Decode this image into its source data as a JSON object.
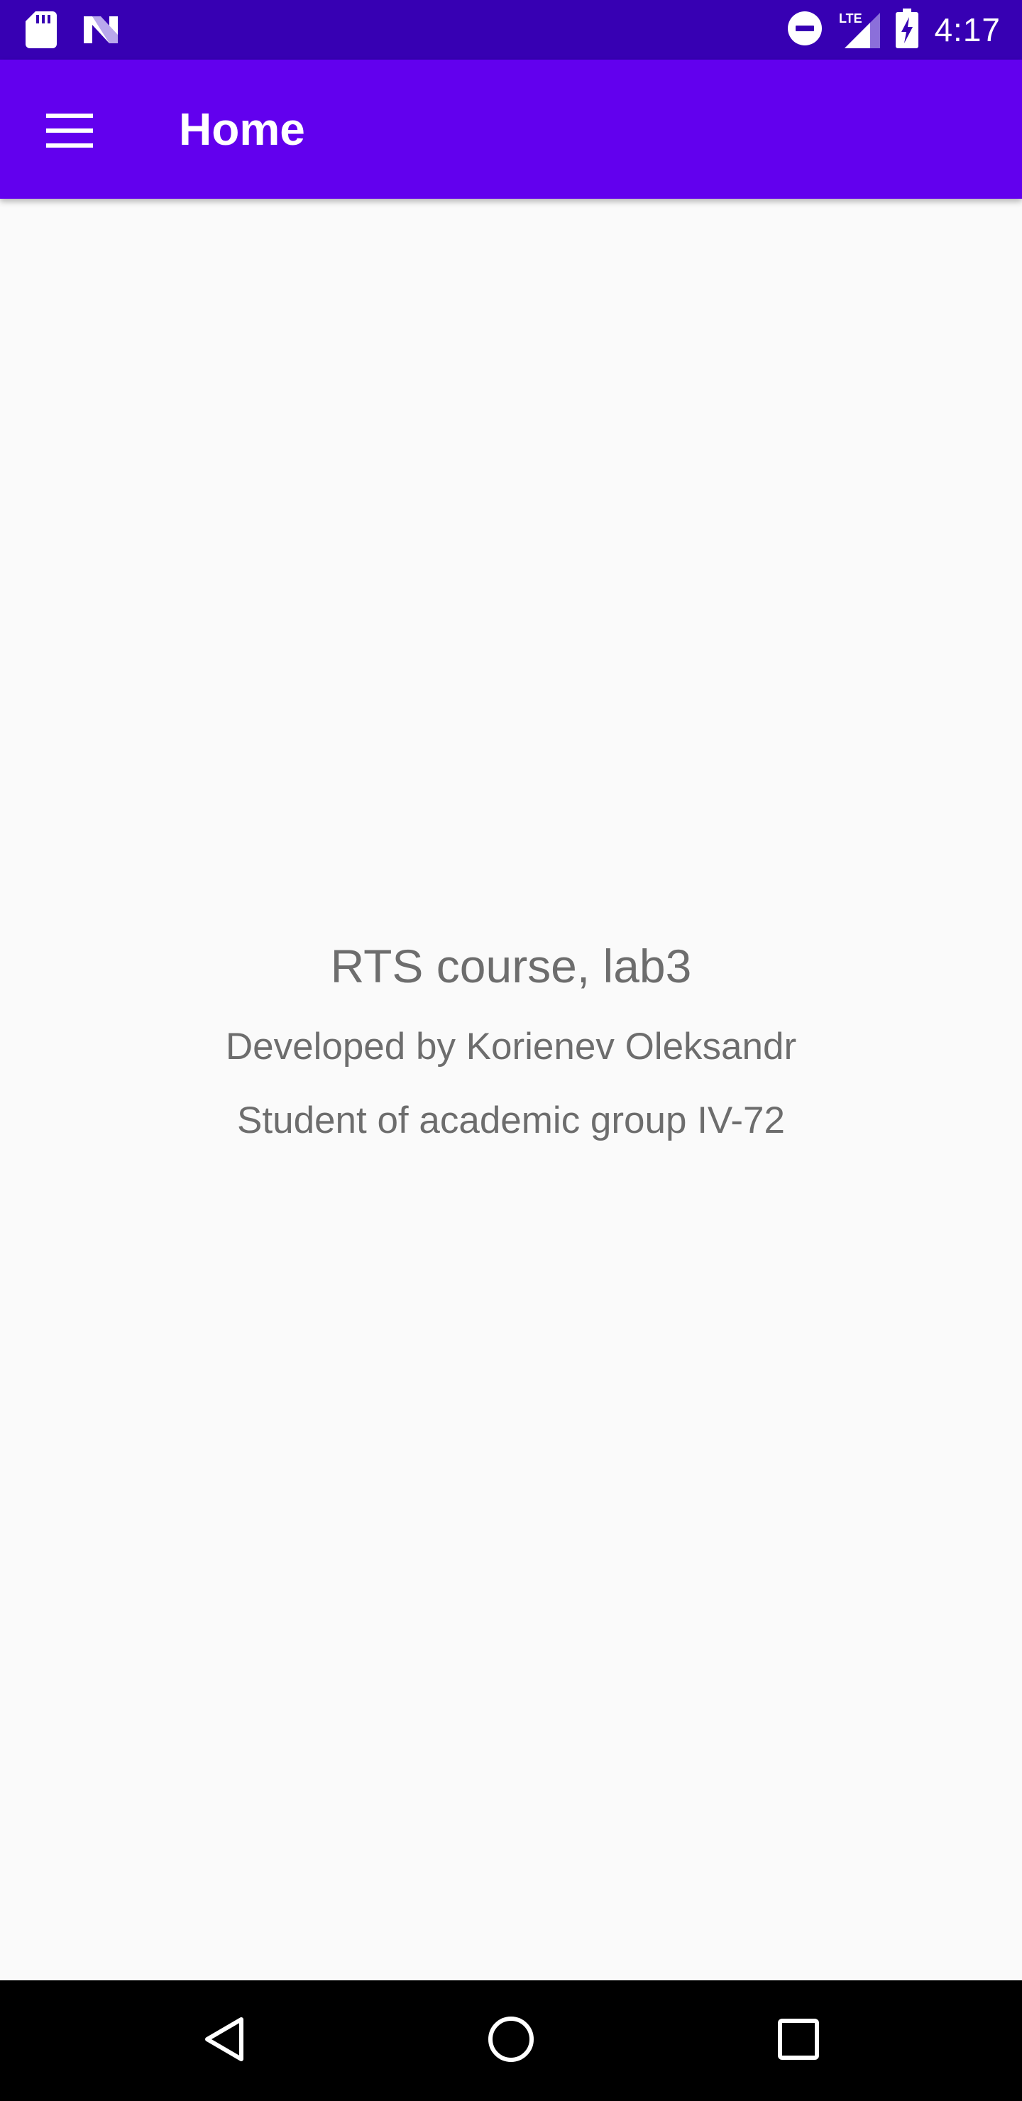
{
  "status_bar": {
    "time": "4:17",
    "icons": [
      "sd-card-icon",
      "n-logo-icon",
      "do-not-disturb-icon",
      "lte-signal-icon",
      "battery-charging-icon"
    ],
    "lte_label": "LTE"
  },
  "app_bar": {
    "title": "Home",
    "menu_icon": "hamburger-menu-icon",
    "color": "#6200EE",
    "status_color": "#3700B3"
  },
  "content": {
    "course_title": "RTS course, lab3",
    "developer": "Developed by Korienev Oleksandr",
    "group": "Student of academic group IV-72",
    "text_color": "#6D6D6D",
    "background": "#FAFAFA"
  },
  "nav_bar": {
    "buttons": [
      "back-icon",
      "home-icon",
      "recents-icon"
    ]
  }
}
